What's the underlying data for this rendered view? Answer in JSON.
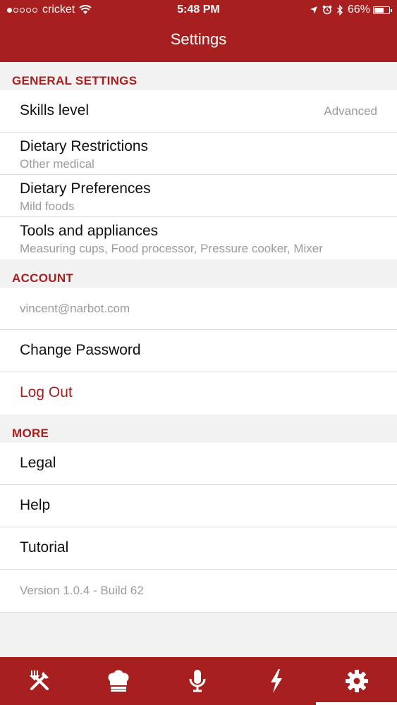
{
  "status_bar": {
    "carrier": "cricket",
    "time": "5:48 PM",
    "battery": "66%",
    "battery_level": 0.66
  },
  "header": {
    "title": "Settings"
  },
  "sections": {
    "general": {
      "title": "GENERAL SETTINGS",
      "skills": {
        "label": "Skills level",
        "value": "Advanced"
      },
      "restrictions": {
        "label": "Dietary Restrictions",
        "value": "Other medical"
      },
      "preferences": {
        "label": "Dietary Preferences",
        "value": "Mild foods"
      },
      "tools": {
        "label": "Tools and appliances",
        "value": "Measuring cups, Food processor, Pressure cooker, Mixer"
      }
    },
    "account": {
      "title": "ACCOUNT",
      "email": "vincent@narbot.com",
      "change_password": "Change Password",
      "logout": "Log Out"
    },
    "more": {
      "title": "MORE",
      "legal": "Legal",
      "help": "Help",
      "tutorial": "Tutorial",
      "version": "Version 1.0.4 - Build 62"
    }
  },
  "tabbar": {
    "tabs": [
      {
        "icon": "fork-knife-icon"
      },
      {
        "icon": "chef-hat-icon"
      },
      {
        "icon": "microphone-icon"
      },
      {
        "icon": "lightning-icon"
      },
      {
        "icon": "gear-icon",
        "active": true
      }
    ]
  },
  "colors": {
    "accent": "#a81f1f",
    "muted": "#9b9b9b",
    "background": "#f2f2f2"
  }
}
